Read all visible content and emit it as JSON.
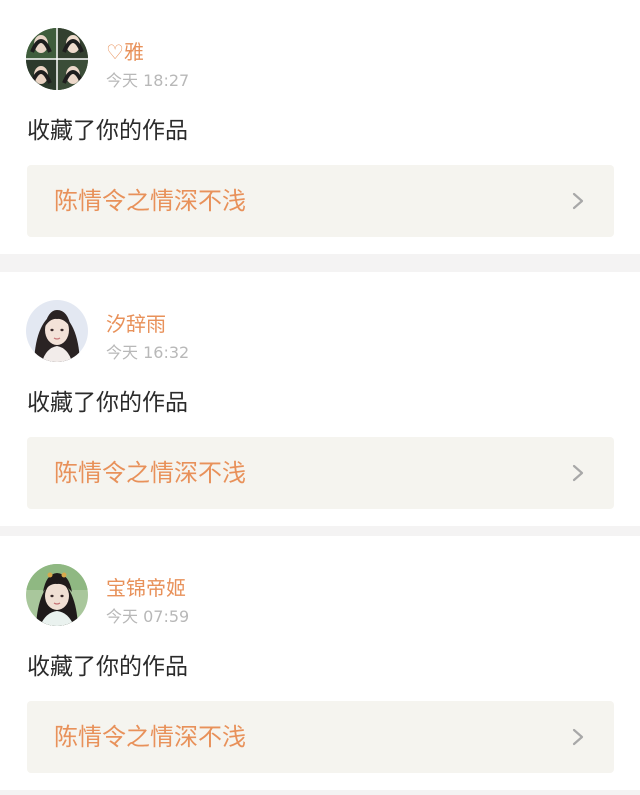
{
  "notifications": [
    {
      "username": "♡雅",
      "timestamp": "今天 18:27",
      "action": "收藏了你的作品",
      "work_title": "陈情令之情深不浅",
      "avatar": "collage-avatar"
    },
    {
      "username": "汐辞雨",
      "timestamp": "今天 16:32",
      "action": "收藏了你的作品",
      "work_title": "陈情令之情深不浅",
      "avatar": "portrait-avatar"
    },
    {
      "username": "宝锦帝姬",
      "timestamp": "今天 07:59",
      "action": "收藏了你的作品",
      "work_title": "陈情令之情深不浅",
      "avatar": "portrait-avatar"
    }
  ],
  "colors": {
    "accent": "#e8915a",
    "timestamp": "#b8b8b8",
    "work_box_bg": "#f5f4ef",
    "page_bg": "#f4f3f3"
  },
  "icons": {
    "chevron": "chevron-right-icon"
  }
}
